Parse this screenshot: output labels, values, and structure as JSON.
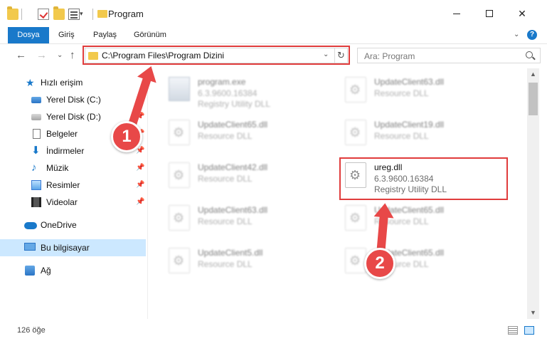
{
  "window": {
    "title": "Program",
    "minimize": "—",
    "maximize": "",
    "close": "✕"
  },
  "quick_access_arrow": "▾",
  "ribbon": {
    "tabs": [
      "Dosya",
      "Giriş",
      "Paylaş",
      "Görünüm"
    ],
    "collapse": "⌄",
    "help": "?"
  },
  "nav": {
    "back": "←",
    "forward": "→",
    "recent": "⌄",
    "up": "↑"
  },
  "address": {
    "path": "C:\\Program Files\\Program Dizini",
    "dropdown": "⌄",
    "refresh": "↻"
  },
  "search": {
    "placeholder": "Ara: Program"
  },
  "sidebar": {
    "items": [
      {
        "label": "Hızlı erişim",
        "icon": "star-icon",
        "pinned": false
      },
      {
        "label": "Yerel Disk (C:)",
        "icon": "disk-c-icon",
        "pinned": true
      },
      {
        "label": "Yerel Disk (D:)",
        "icon": "disk-icon",
        "pinned": true
      },
      {
        "label": "Belgeler",
        "icon": "document-icon",
        "pinned": true
      },
      {
        "label": "İndirmeler",
        "icon": "download-icon",
        "pinned": true
      },
      {
        "label": "Müzik",
        "icon": "music-icon",
        "pinned": true
      },
      {
        "label": "Resimler",
        "icon": "pictures-icon",
        "pinned": true
      },
      {
        "label": "Videolar",
        "icon": "videos-icon",
        "pinned": true
      },
      {
        "label": "OneDrive",
        "icon": "onedrive-icon",
        "pinned": false
      },
      {
        "label": "Bu bilgisayar",
        "icon": "this-pc-icon",
        "pinned": false,
        "selected": true
      },
      {
        "label": "Ağ",
        "icon": "network-icon",
        "pinned": false
      }
    ],
    "pin_glyph": "📌"
  },
  "files": [
    {
      "name": "program.exe",
      "line2": "6.3.9600.16384",
      "line3": "Registry Utility DLL",
      "kind": "exe"
    },
    {
      "name": "UpdateClient63.dll",
      "line2": "Resource DLL",
      "line3": "",
      "kind": "dll"
    },
    {
      "name": "UpdateClient65.dll",
      "line2": "Resource DLL",
      "line3": "",
      "kind": "dll"
    },
    {
      "name": "UpdateClient19.dll",
      "line2": "Resource DLL",
      "line3": "",
      "kind": "dll"
    },
    {
      "name": "UpdateClient42.dll",
      "line2": "Resource DLL",
      "line3": "",
      "kind": "dll"
    },
    {
      "name": "ureg.dll",
      "line2": "6.3.9600.16384",
      "line3": "Registry Utility DLL",
      "kind": "dll"
    },
    {
      "name": "UpdateClient63.dll",
      "line2": "Resource DLL",
      "line3": "",
      "kind": "dll"
    },
    {
      "name": "UpdateClient65.dll",
      "line2": "Resource DLL",
      "line3": "",
      "kind": "dll"
    },
    {
      "name": "UpdateClient5.dll",
      "line2": "Resource DLL",
      "line3": "",
      "kind": "dll"
    },
    {
      "name": "UpdateClient65.dll",
      "line2": "Resource DLL",
      "line3": "",
      "kind": "dll"
    }
  ],
  "scrollbar": {
    "up": "▲",
    "down": "▼"
  },
  "status": {
    "item_count": "126 öğe"
  },
  "callouts": [
    "1",
    "2"
  ],
  "colors": {
    "accent": "#1979ca",
    "highlight": "#e03c3c",
    "selected_bg": "#cce8ff"
  }
}
